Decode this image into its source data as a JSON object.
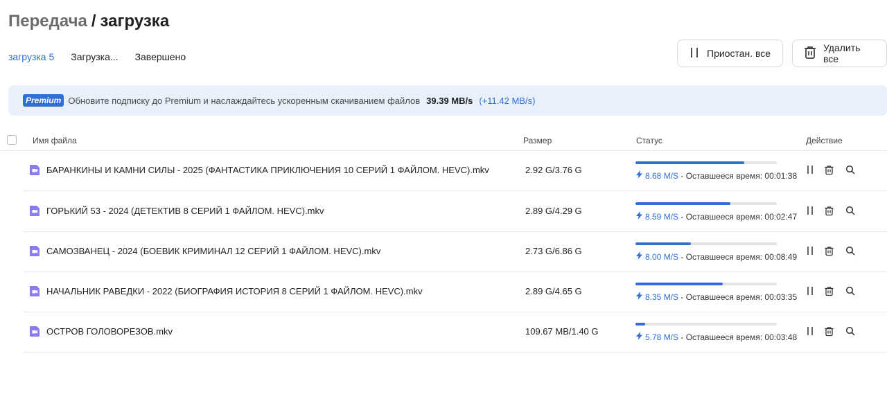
{
  "header": {
    "parent": "Передача",
    "separator": "/",
    "current": "загрузка"
  },
  "tabs": [
    {
      "label": "загрузка 5",
      "active": true
    },
    {
      "label": "Загрузка..."
    },
    {
      "label": "Завершено"
    }
  ],
  "toolbar": {
    "pause_all": "Приостан. все",
    "delete_all": "Удалить все"
  },
  "banner": {
    "badge": "Premium",
    "text": "Обновите подписку до Premium и наслаждайтесь ускоренным скачиванием файлов",
    "speed": "39.39 MB/s",
    "extra": "(+11.42 MB/s)"
  },
  "columns": {
    "name": "Имя файла",
    "size": "Размер",
    "status": "Статус",
    "action": "Действие"
  },
  "files": [
    {
      "name": "БАРАНКИНЫ И КАМНИ СИЛЫ - 2025 (ФАНТАСТИКА ПРИКЛЮЧЕНИЯ 10 СЕРИЙ 1 ФАЙЛОМ. HEVC).mkv",
      "size": "2.92 G/3.76 G",
      "progress": 0.77,
      "speed": "8.68 M/S",
      "remaining_label": "- Оставшееся время:",
      "remaining": "00:01:38"
    },
    {
      "name": "ГОРЬКИЙ 53 - 2024 (ДЕТЕКТИВ 8 СЕРИЙ 1 ФАЙЛОМ. HEVC).mkv",
      "size": "2.89 G/4.29 G",
      "progress": 0.67,
      "speed": "8.59 M/S",
      "remaining_label": "- Оставшееся время:",
      "remaining": "00:02:47"
    },
    {
      "name": "САМОЗВАНЕЦ - 2024 (БОЕВИК КРИМИНАЛ 12 СЕРИЙ 1 ФАЙЛОМ. HEVC).mkv",
      "size": "2.73 G/6.86 G",
      "progress": 0.39,
      "speed": "8.00 M/S",
      "remaining_label": "- Оставшееся время:",
      "remaining": "00:08:49"
    },
    {
      "name": "НАЧАЛЬНИК РАВЕДКИ - 2022 (БИОГРАФИЯ ИСТОРИЯ 8 СЕРИЙ 1 ФАЙЛОМ. HEVC).mkv",
      "size": "2.89 G/4.65 G",
      "progress": 0.62,
      "speed": "8.35 M/S",
      "remaining_label": "- Оставшееся время:",
      "remaining": "00:03:35"
    },
    {
      "name": "ОСТРОВ ГОЛОВОРЕЗОВ.mkv",
      "size": "109.67 MB/1.40 G",
      "progress": 0.07,
      "speed": "5.78 M/S",
      "remaining_label": "- Оставшееся время:",
      "remaining": "00:03:48"
    }
  ],
  "colors": {
    "accent": "#2f6fd6",
    "file_icon": "#8a7cf0",
    "banner_bg": "#e8f0fb"
  },
  "icons": {
    "file": "video-file-icon",
    "pause": "pause-icon",
    "delete": "trash-icon",
    "locate": "search-icon",
    "speed": "bolt-icon"
  }
}
